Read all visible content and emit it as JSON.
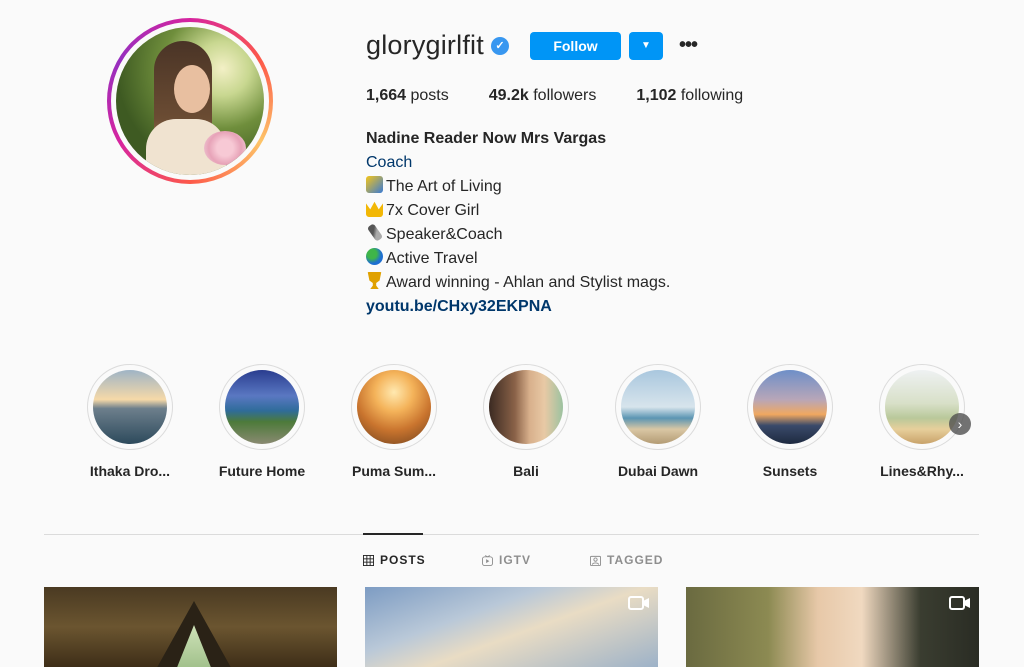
{
  "profile": {
    "username": "glorygirlfit",
    "follow_label": "Follow",
    "dropdown_icon": "chevron-down-icon",
    "more_icon": "more-options-icon",
    "stats": [
      {
        "count": "1,664",
        "label": " posts"
      },
      {
        "count": "49.2k",
        "label": " followers"
      },
      {
        "count": "1,102",
        "label": " following"
      }
    ],
    "bio": {
      "name": "Nadine Reader Now Mrs Vargas",
      "category": "Coach",
      "lines": [
        {
          "icon": "sparkle-star-icon",
          "text": "The Art of Living"
        },
        {
          "icon": "crown-icon",
          "text": "7x Cover Girl"
        },
        {
          "icon": "microphone-icon",
          "text": "Speaker&Coach"
        },
        {
          "icon": "globe-icon",
          "text": "Active Travel"
        },
        {
          "icon": "trophy-icon",
          "text": "Award winning - Ahlan and Stylist mags."
        }
      ],
      "link": "youtu.be/CHxy32EKPNA"
    }
  },
  "highlights": [
    {
      "label": "Ithaka Dro..."
    },
    {
      "label": "Future Home"
    },
    {
      "label": "Puma Sum..."
    },
    {
      "label": "Bali"
    },
    {
      "label": "Dubai Dawn"
    },
    {
      "label": "Sunsets"
    },
    {
      "label": "Lines&Rhy..."
    }
  ],
  "tabs": [
    {
      "label": "POSTS",
      "icon": "grid-icon",
      "active": true
    },
    {
      "label": "IGTV",
      "icon": "igtv-icon",
      "active": false
    },
    {
      "label": "TAGGED",
      "icon": "tagged-icon",
      "active": false
    }
  ],
  "colors": {
    "accent": "#0095f6",
    "link": "#00376b",
    "verified": "#3897f0"
  }
}
